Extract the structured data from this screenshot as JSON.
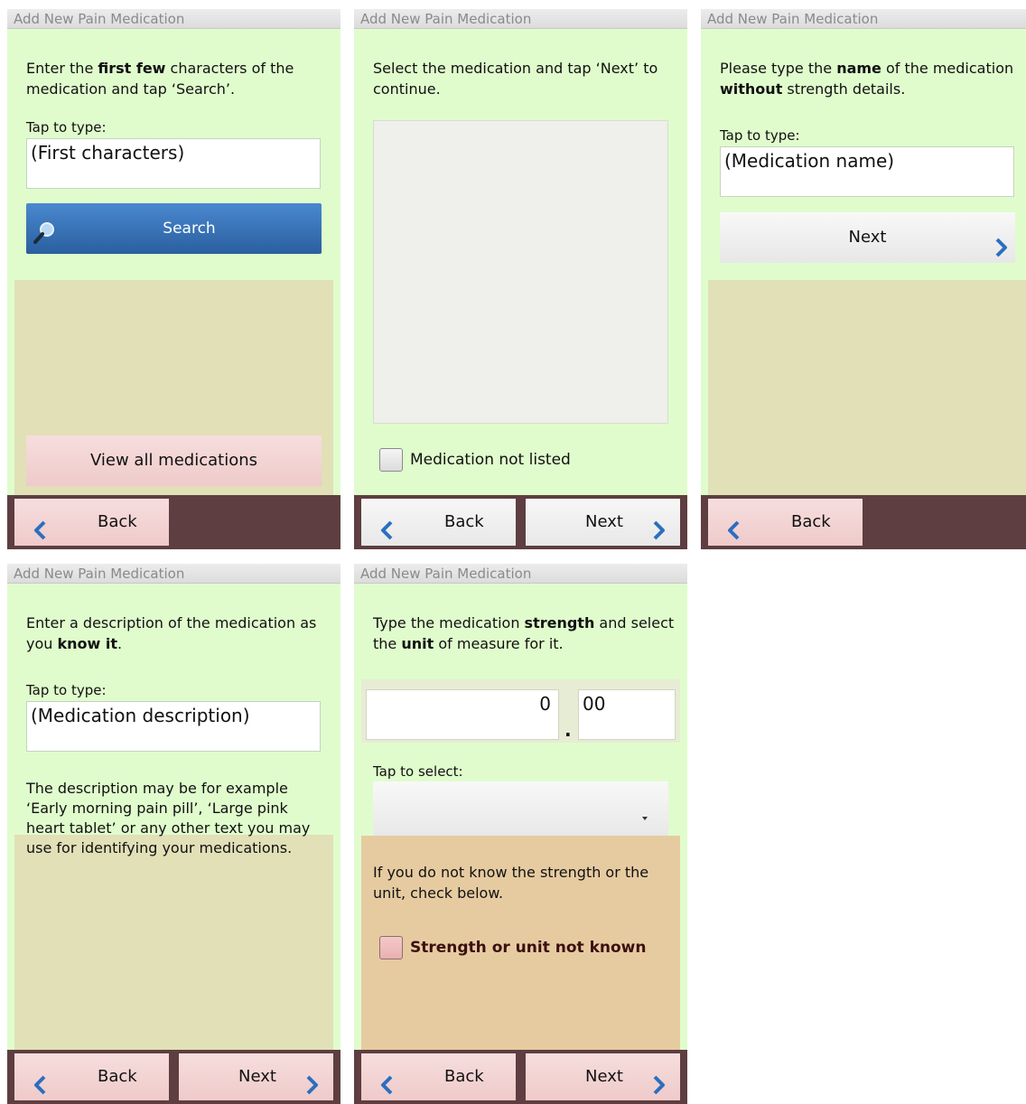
{
  "app_title": "Add New Pain Medication",
  "nav": {
    "back": "Back",
    "next": "Next"
  },
  "screen1": {
    "instr_pre": "Enter the ",
    "instr_bold": "first few",
    "instr_post": " characters of the medication and tap ‘Search’.",
    "tap_label": "Tap to type:",
    "input_placeholder": "(First characters)",
    "search_label": "Search",
    "view_all_label": "View all medications"
  },
  "screen2": {
    "instr": "Select the medication and tap ‘Next’ to continue.",
    "not_listed_label": "Medication not listed"
  },
  "screen3": {
    "instr_pre": "Please type the ",
    "instr_bold1": "name",
    "instr_mid": " of the medication ",
    "instr_bold2": "without",
    "instr_post": " strength details.",
    "tap_label": "Tap to type:",
    "input_placeholder": "(Medication name)",
    "next_label": "Next"
  },
  "screen4": {
    "instr_pre": "Enter a description of the medication as you ",
    "instr_bold": "know it",
    "instr_post": ".",
    "tap_label": "Tap to type:",
    "input_placeholder": "(Medication description)",
    "example_text": "The description may be for example ‘Early morning pain pill’, ‘Large pink heart tablet’ or any other text you may use for identifying your medications."
  },
  "screen5": {
    "instr_pre": "Type the medication ",
    "instr_bold1": "strength",
    "instr_mid": " and select the ",
    "instr_bold2": "unit",
    "instr_post": " of measure for it.",
    "integer_value": "0",
    "decimal_point": ".",
    "decimal_value": "00",
    "tap_select_label": "Tap to select:",
    "select_value": "",
    "unknown_instr": "If you do not know the strength or the unit, check below.",
    "unknown_label": "Strength or unit not known"
  },
  "colors": {
    "screen_bg": "#e0fccd",
    "region_bg": "#e1e0b7",
    "bottom_bar": "#5e3e40",
    "search_blue": "#2f6bb0",
    "pink_button": "#f2d2d1",
    "tan_panel": "#e6cba1",
    "chevron_blue": "#2a6fc0"
  }
}
